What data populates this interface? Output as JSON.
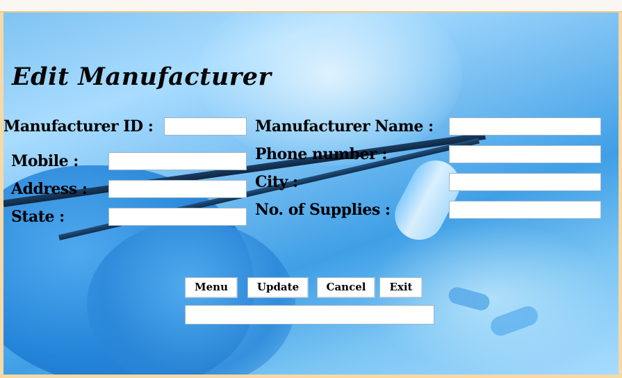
{
  "form": {
    "title": "Edit Manufacturer",
    "labels": {
      "manufacturer_id": "Manufacturer ID :",
      "manufacturer_name": "Manufacturer Name :",
      "mobile": "Mobile :",
      "phone_number": "Phone number :",
      "address": "Address :",
      "city": "City :",
      "state": "State :",
      "no_of_supplies": "No. of Supplies :"
    },
    "values": {
      "manufacturer_id": "",
      "manufacturer_name": "",
      "mobile": "",
      "phone_number": "",
      "address": "",
      "city": "",
      "state": "",
      "no_of_supplies": "",
      "status": ""
    }
  },
  "buttons": {
    "menu": "Menu",
    "update": "Update",
    "cancel": "Cancel",
    "exit": "Exit"
  },
  "colors": {
    "background_accent": "#3f9fe6",
    "frame": "#f7d9a8",
    "text": "#000000"
  }
}
